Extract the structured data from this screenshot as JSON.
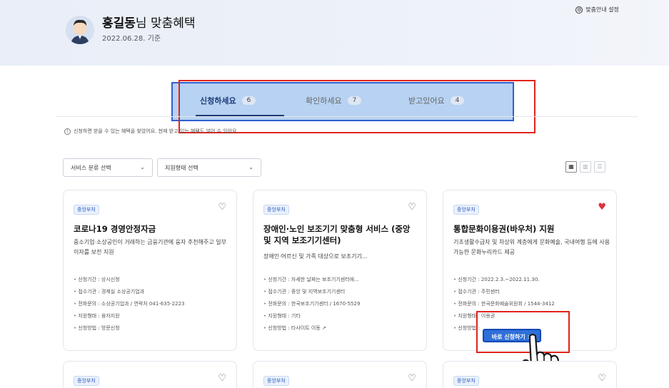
{
  "header": {
    "user_name": "홍길동",
    "title_suffix": "님 맞춤혜택",
    "date": "2022.06.28. 기준",
    "settings_label": "맞춤안내 설정"
  },
  "tabs": [
    {
      "label": "신청하세요",
      "count": "6",
      "active": true
    },
    {
      "label": "확인하세요",
      "count": "7",
      "active": false
    },
    {
      "label": "받고있어요",
      "count": "4",
      "active": false
    }
  ],
  "notice": "신청하면 받을 수 있는 혜택을 찾았어요. 현재 받고 있는 혜택도 넣어 수 있어요.",
  "filters": {
    "service_category": "서비스 분류 선택",
    "support_type": "지원형태 선택"
  },
  "cards": [
    {
      "badge": "중앙부처",
      "title": "코로나19 경영안정자금",
      "desc": "중소기업·소상공인이 거래하는 금융기관에 융자 추천해주고 일부 이자를 보전 지원",
      "info": [
        "신청기간 : 상시신청",
        "접수기관 : 경제실 소상공기업과",
        "전화문의 : 소상공기업과 / 연락처 041-635-2223",
        "지원형태 : 융자지원",
        "신청방법 : 방문신청"
      ],
      "liked": false
    },
    {
      "badge": "중앙부처",
      "title": "장애인·노인 보조기기 맞춤형 서비스 (중앙 및 지역 보조기기센터)",
      "desc": "장애인·어르신 및 가족 대상으로 보조기기...",
      "info": [
        "신청기간 : 자세한 날짜는 보조기기센터에...",
        "접수기관 : 중앙 및 지역보조기기센터",
        "전화문의 : 한국보조기기센터 / 1670-5529",
        "지원형태 : 기타",
        "신청방법 : 타사이트 이동"
      ],
      "liked": false
    },
    {
      "badge": "중앙부처",
      "title": "통합문화이용권(바우처) 지원",
      "desc": "기초생활수급자 및 차상위 계층에게 문화예술, 국내여행 등에 사용 가능한 문화누리카드 제공",
      "info": [
        "신청기간 : 2022.2.3.~2022.11.30.",
        "접수기관 : 주민센터",
        "전화문의 : 한국문화예술위원회 / 1544-3412",
        "지원형태 : 이용권",
        "신청방법 :"
      ],
      "liked": true,
      "apply_label": "바로 신청하기 >"
    }
  ],
  "next_row_badges": [
    "중앙부처",
    "중앙부처",
    "중앙부처"
  ],
  "view_icons": [
    "grid-view-icon",
    "card-view-icon",
    "list-view-icon"
  ],
  "colors": {
    "accent": "#2f6fd8",
    "highlight_red": "#e0241b",
    "highlight_blue": "#2f5fd0",
    "heart": "#e0303c"
  }
}
